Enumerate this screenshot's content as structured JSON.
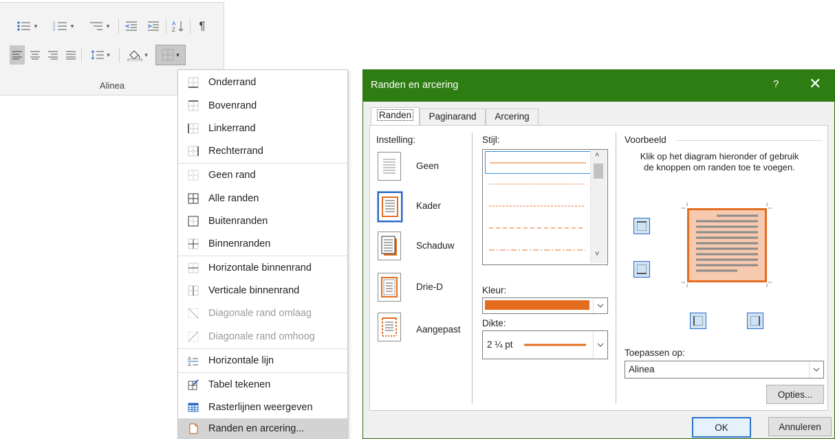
{
  "ribbon": {
    "group_label": "Alinea"
  },
  "menu": {
    "items": [
      {
        "label": "Onderrand",
        "disabled": false
      },
      {
        "label": "Bovenrand",
        "disabled": false
      },
      {
        "label": "Linkerrand",
        "disabled": false
      },
      {
        "label": "Rechterrand",
        "disabled": false
      },
      {
        "label": "Geen rand",
        "disabled": false
      },
      {
        "label": "Alle randen",
        "disabled": false
      },
      {
        "label": "Buitenranden",
        "disabled": false
      },
      {
        "label": "Binnenranden",
        "disabled": false
      },
      {
        "label": "Horizontale binnenrand",
        "disabled": false
      },
      {
        "label": "Verticale binnenrand",
        "disabled": false
      },
      {
        "label": "Diagonale rand omlaag",
        "disabled": true
      },
      {
        "label": "Diagonale rand omhoog",
        "disabled": true
      },
      {
        "label": "Horizontale lijn",
        "disabled": false
      },
      {
        "label": "Tabel tekenen",
        "disabled": false
      },
      {
        "label": "Rasterlijnen weergeven",
        "disabled": false
      },
      {
        "label": "Randen en arcering...",
        "disabled": false,
        "highlighted": true
      }
    ]
  },
  "dialog": {
    "title": "Randen en arcering",
    "help": "?",
    "close": "✕",
    "tabs": [
      "Randen",
      "Paginarand",
      "Arcering"
    ],
    "instelling_label": "Instelling:",
    "settings": [
      "Geen",
      "Kader",
      "Schaduw",
      "Drie-D",
      "Aangepast"
    ],
    "selected_setting": "Kader",
    "stijl_label": "Stijl:",
    "kleur_label": "Kleur:",
    "kleur_value": "#E46C1F",
    "dikte_label": "Dikte:",
    "dikte_value": "2 ¼ pt",
    "voorbeeld_label": "Voorbeeld",
    "voorbeeld_hint": "Klik op het diagram hieronder of gebruik de knoppen om randen toe te voegen.",
    "toepassen_label": "Toepassen op:",
    "toepassen_value": "Alinea",
    "opties": "Opties...",
    "ok": "OK",
    "cancel": "Annuleren"
  },
  "colors": {
    "accent_green": "#2e7d12",
    "border_orange": "#E46C1F",
    "preview_fill": "#F7C9AE",
    "selection_blue": "#2a69c2"
  }
}
